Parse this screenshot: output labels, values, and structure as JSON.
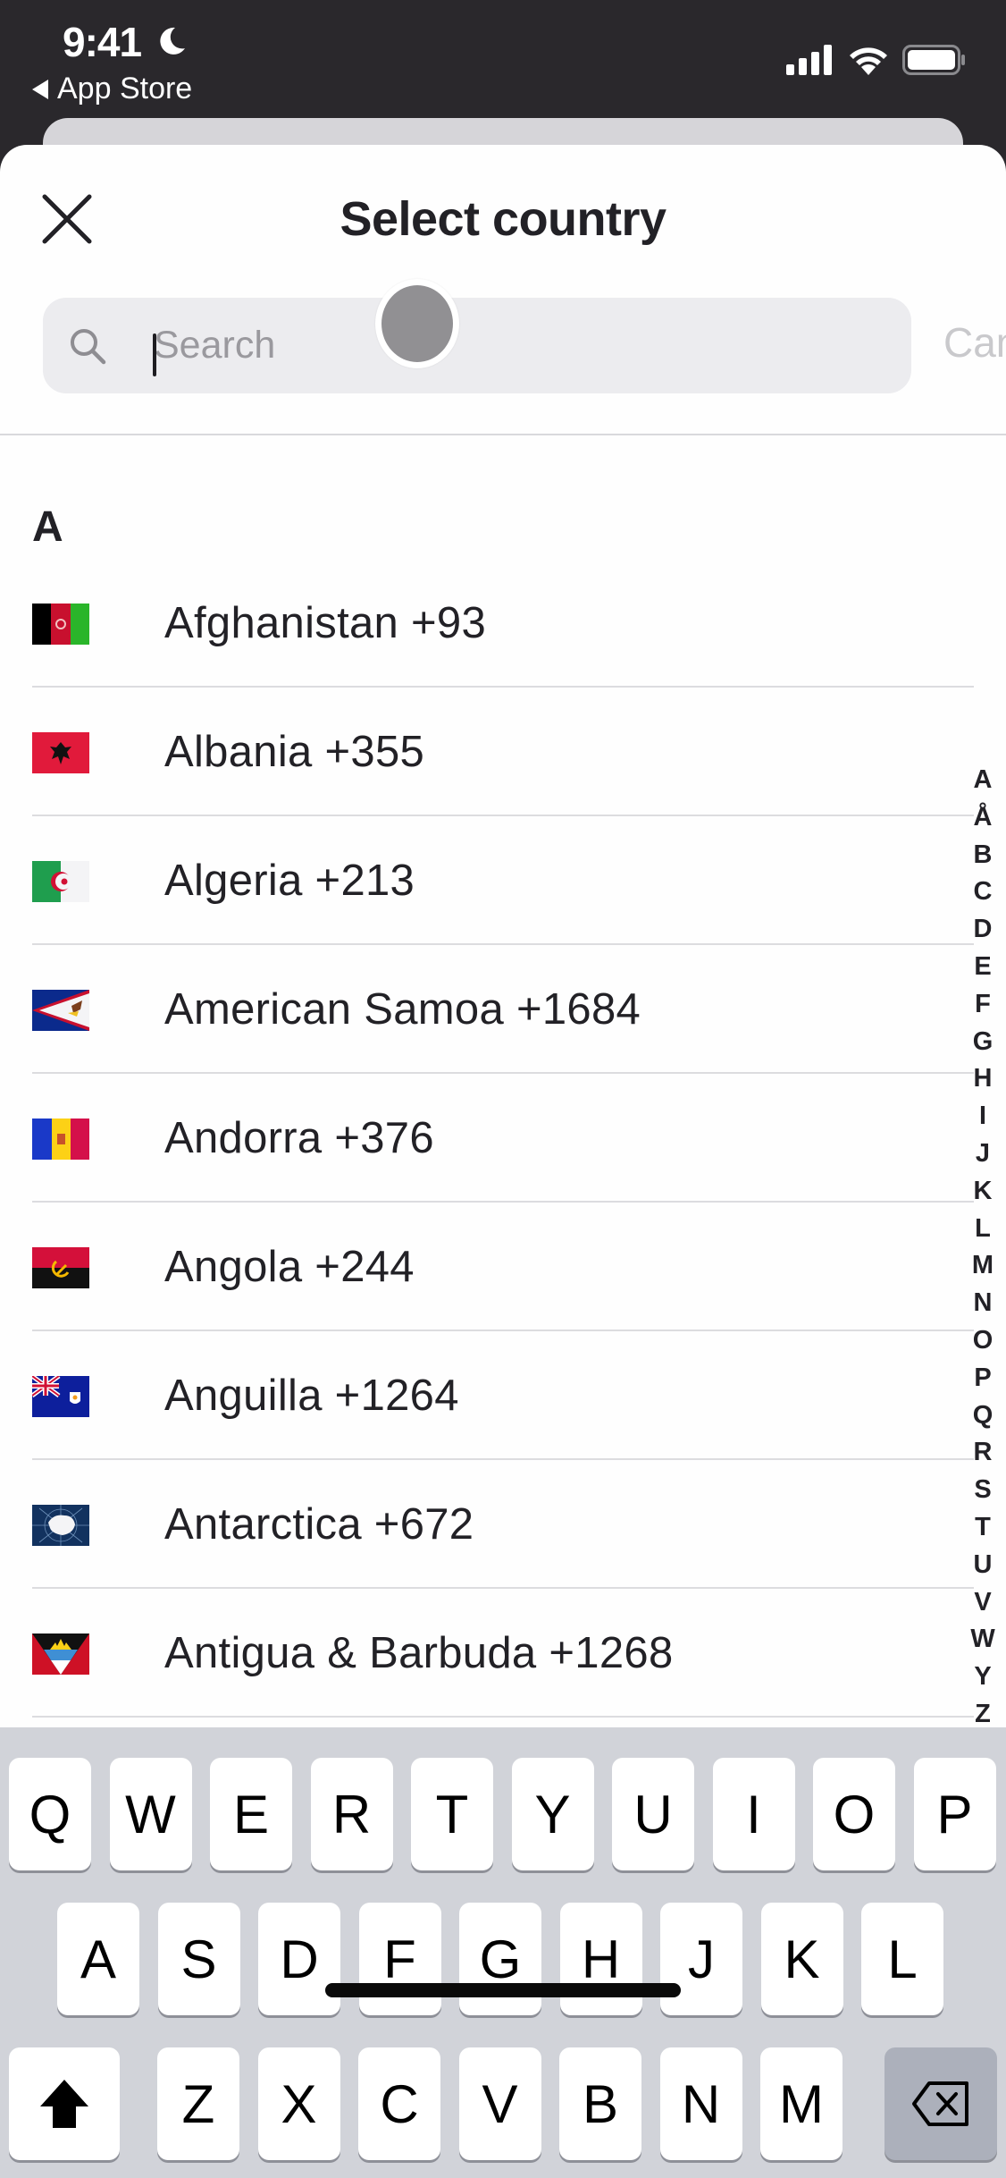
{
  "status_bar": {
    "time": "9:41",
    "focus_icon": "moon-icon",
    "back_app": "App Store",
    "icons": [
      "cellular-signal-icon",
      "wifi-icon",
      "battery-icon"
    ]
  },
  "header": {
    "title": "Select country",
    "close_icon": "close-icon"
  },
  "search": {
    "placeholder": "Search",
    "value": "",
    "cancel_label": "Cancel"
  },
  "list": {
    "section": "A",
    "countries": [
      {
        "label": "Afghanistan +93",
        "flag": "af"
      },
      {
        "label": "Albania +355",
        "flag": "al"
      },
      {
        "label": "Algeria +213",
        "flag": "dz"
      },
      {
        "label": "American Samoa +1684",
        "flag": "as"
      },
      {
        "label": "Andorra +376",
        "flag": "ad"
      },
      {
        "label": "Angola +244",
        "flag": "ao"
      },
      {
        "label": "Anguilla +1264",
        "flag": "ai"
      },
      {
        "label": "Antarctica +672",
        "flag": "aq"
      },
      {
        "label": "Antigua & Barbuda +1268",
        "flag": "ag"
      }
    ]
  },
  "index_letters": [
    "A",
    "Å",
    "B",
    "C",
    "D",
    "E",
    "F",
    "G",
    "H",
    "I",
    "J",
    "K",
    "L",
    "M",
    "N",
    "O",
    "P",
    "Q",
    "R",
    "S",
    "T",
    "U",
    "V",
    "W",
    "Y",
    "Z"
  ],
  "keyboard": {
    "row1": [
      "Q",
      "W",
      "E",
      "R",
      "T",
      "Y",
      "U",
      "I",
      "O",
      "P"
    ],
    "row2": [
      "A",
      "S",
      "D",
      "F",
      "G",
      "H",
      "J",
      "K",
      "L"
    ],
    "row3": [
      "Z",
      "X",
      "C",
      "V",
      "B",
      "N",
      "M"
    ],
    "shift_icon": "shift-icon",
    "delete_icon": "backspace-icon"
  },
  "colors": {
    "status_bg": "#2a282c",
    "search_bg": "#ececef",
    "keyboard_bg": "#d1d3d9",
    "text": "#222126",
    "placeholder": "#9a999e"
  }
}
